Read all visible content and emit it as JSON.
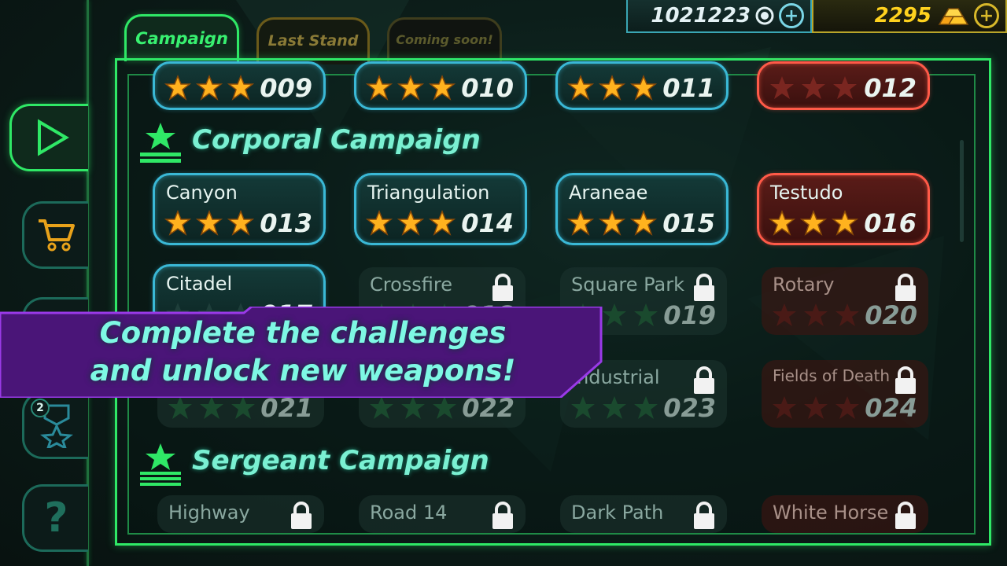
{
  "currency": {
    "coins": "1021223",
    "gold": "2295",
    "coin_icon": "coin-icon",
    "gold_icon": "gold-bars-icon"
  },
  "tabs": [
    {
      "label": "Campaign",
      "state": "active"
    },
    {
      "label": "Last Stand",
      "state": "inactive"
    },
    {
      "label": "Coming soon!",
      "state": "disabled"
    }
  ],
  "sidebar": {
    "items": [
      {
        "icon": "play-icon",
        "active": true
      },
      {
        "icon": "cart-icon"
      },
      {
        "icon": "upgrade-icon"
      },
      {
        "icon": "medal-icon",
        "badge": "2"
      },
      {
        "icon": "help-icon",
        "label": "?"
      }
    ]
  },
  "sections": [
    {
      "title": "Corporal Campaign"
    },
    {
      "title": "Sergeant Campaign"
    }
  ],
  "levels_top": [
    {
      "num": "009",
      "stars": 3
    },
    {
      "num": "010",
      "stars": 3
    },
    {
      "num": "011",
      "stars": 3
    },
    {
      "num": "012",
      "stars": 0
    }
  ],
  "levels_corporal": [
    {
      "name": "Canyon",
      "num": "013",
      "stars": 3
    },
    {
      "name": "Triangulation",
      "num": "014",
      "stars": 3
    },
    {
      "name": "Araneae",
      "num": "015",
      "stars": 3
    },
    {
      "name": "Testudo",
      "num": "016",
      "stars": 3
    },
    {
      "name": "Citadel",
      "num": "017",
      "stars": 0
    },
    {
      "name": "Crossfire",
      "num": "018",
      "stars": 0,
      "locked": true
    },
    {
      "name": "Square Park",
      "num": "019",
      "stars": 0,
      "locked": true
    },
    {
      "name": "Rotary",
      "num": "020",
      "stars": 0,
      "locked": true
    },
    {
      "name": "",
      "num": "021",
      "stars": 0,
      "locked": true
    },
    {
      "name": "",
      "num": "022",
      "stars": 0,
      "locked": true
    },
    {
      "name": "Industrial",
      "num": "023",
      "stars": 0,
      "locked": true
    },
    {
      "name": "Fields of Death",
      "num": "024",
      "stars": 0,
      "locked": true
    }
  ],
  "levels_sergeant": [
    {
      "name": "Highway",
      "locked": true
    },
    {
      "name": "Road 14",
      "locked": true
    },
    {
      "name": "Dark Path",
      "locked": true
    },
    {
      "name": "White Horse",
      "locked": true
    }
  ],
  "promo": {
    "line1": "Complete the challenges",
    "line2": "and unlock new weapons!"
  },
  "colors": {
    "accent_green": "#2fe866",
    "card_blue": "#3ab8d6",
    "card_red": "#ff5a48",
    "star_gold": "#ffb21e",
    "promo_purple": "#5a1a8a"
  }
}
